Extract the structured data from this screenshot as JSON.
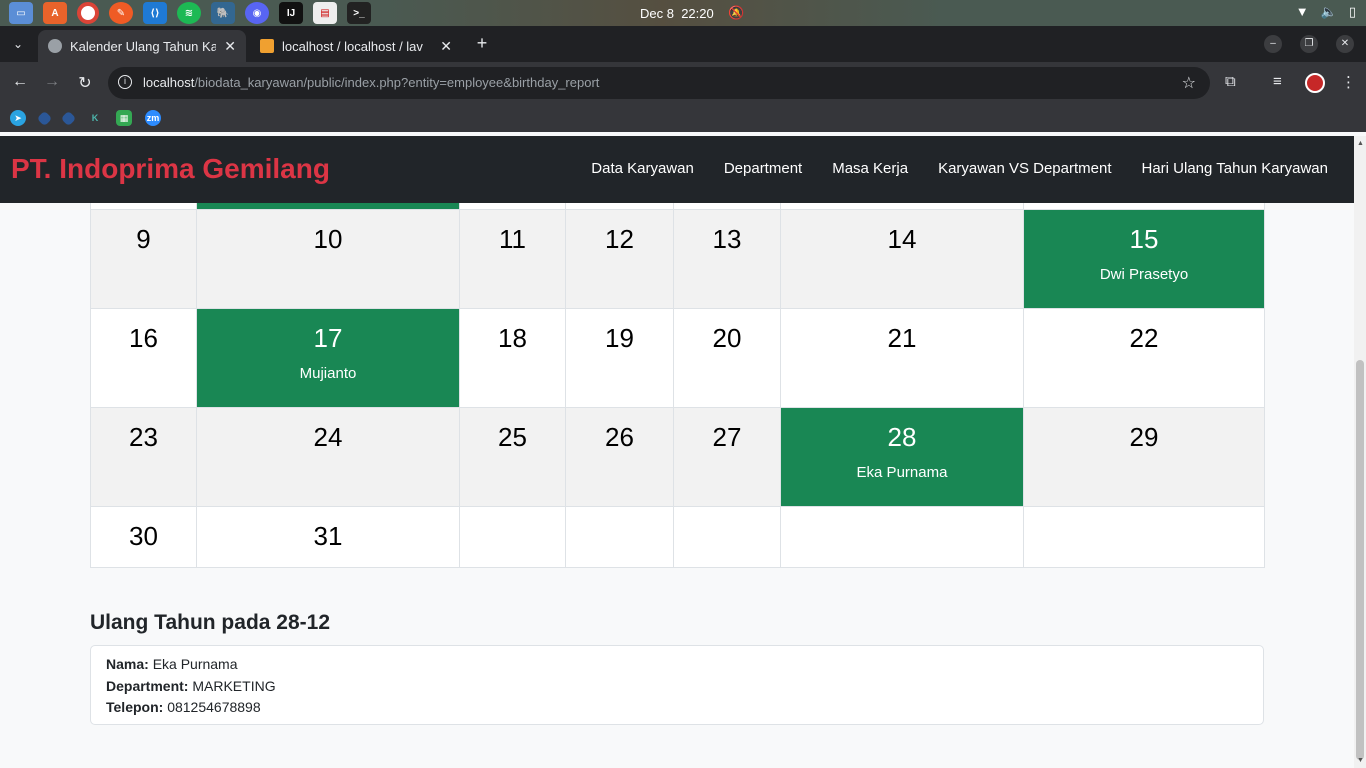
{
  "os": {
    "clock_date": "Dec 8",
    "clock_time": "22:20",
    "apps": [
      "files-icon",
      "app-a-icon",
      "chrome-icon",
      "postman-icon",
      "vscode-icon",
      "spotify-icon",
      "pgadmin-icon",
      "discord-icon",
      "intellij-icon",
      "document-icon",
      "terminal-icon"
    ]
  },
  "browser": {
    "tabs": [
      {
        "title": "Kalender Ulang Tahun Ka"
      },
      {
        "title": "localhost / localhost / lav"
      }
    ],
    "url_host": "localhost",
    "url_path": "/biodata_karyawan/public/index.php?entity=employee&birthday_report"
  },
  "navbar": {
    "brand": "PT. Indoprima Gemilang",
    "menu": [
      "Data Karyawan",
      "Department",
      "Masa Kerja",
      "Karyawan VS Department",
      "Hari Ulang Tahun Karyawan"
    ]
  },
  "calendar": {
    "weeks": [
      {
        "days": [
          {
            "n": ""
          },
          {
            "n": ""
          },
          {
            "n": ""
          },
          {
            "n": ""
          },
          {
            "n": ""
          },
          {
            "n": ""
          },
          {
            "n": ""
          }
        ]
      },
      {
        "days": [
          {
            "n": "9"
          },
          {
            "n": "10"
          },
          {
            "n": "11"
          },
          {
            "n": "12"
          },
          {
            "n": "13"
          },
          {
            "n": "14"
          },
          {
            "n": "15",
            "name": "Dwi Prasetyo"
          }
        ]
      },
      {
        "days": [
          {
            "n": "16"
          },
          {
            "n": "17",
            "name": "Mujianto"
          },
          {
            "n": "18"
          },
          {
            "n": "19"
          },
          {
            "n": "20"
          },
          {
            "n": "21"
          },
          {
            "n": "22"
          }
        ]
      },
      {
        "days": [
          {
            "n": "23"
          },
          {
            "n": "24"
          },
          {
            "n": "25"
          },
          {
            "n": "26"
          },
          {
            "n": "27"
          },
          {
            "n": "28",
            "name": "Eka Purnama"
          },
          {
            "n": "29"
          }
        ]
      },
      {
        "days": [
          {
            "n": "30"
          },
          {
            "n": "31"
          },
          {
            "n": ""
          },
          {
            "n": ""
          },
          {
            "n": ""
          },
          {
            "n": ""
          },
          {
            "n": ""
          }
        ]
      }
    ]
  },
  "detail": {
    "title": "Ulang Tahun pada 28-12",
    "name_label": "Nama:",
    "name": "Eka Purnama",
    "dept_label": "Department:",
    "dept": "MARKETING",
    "phone_label": "Telepon:",
    "phone": "081254678898"
  }
}
